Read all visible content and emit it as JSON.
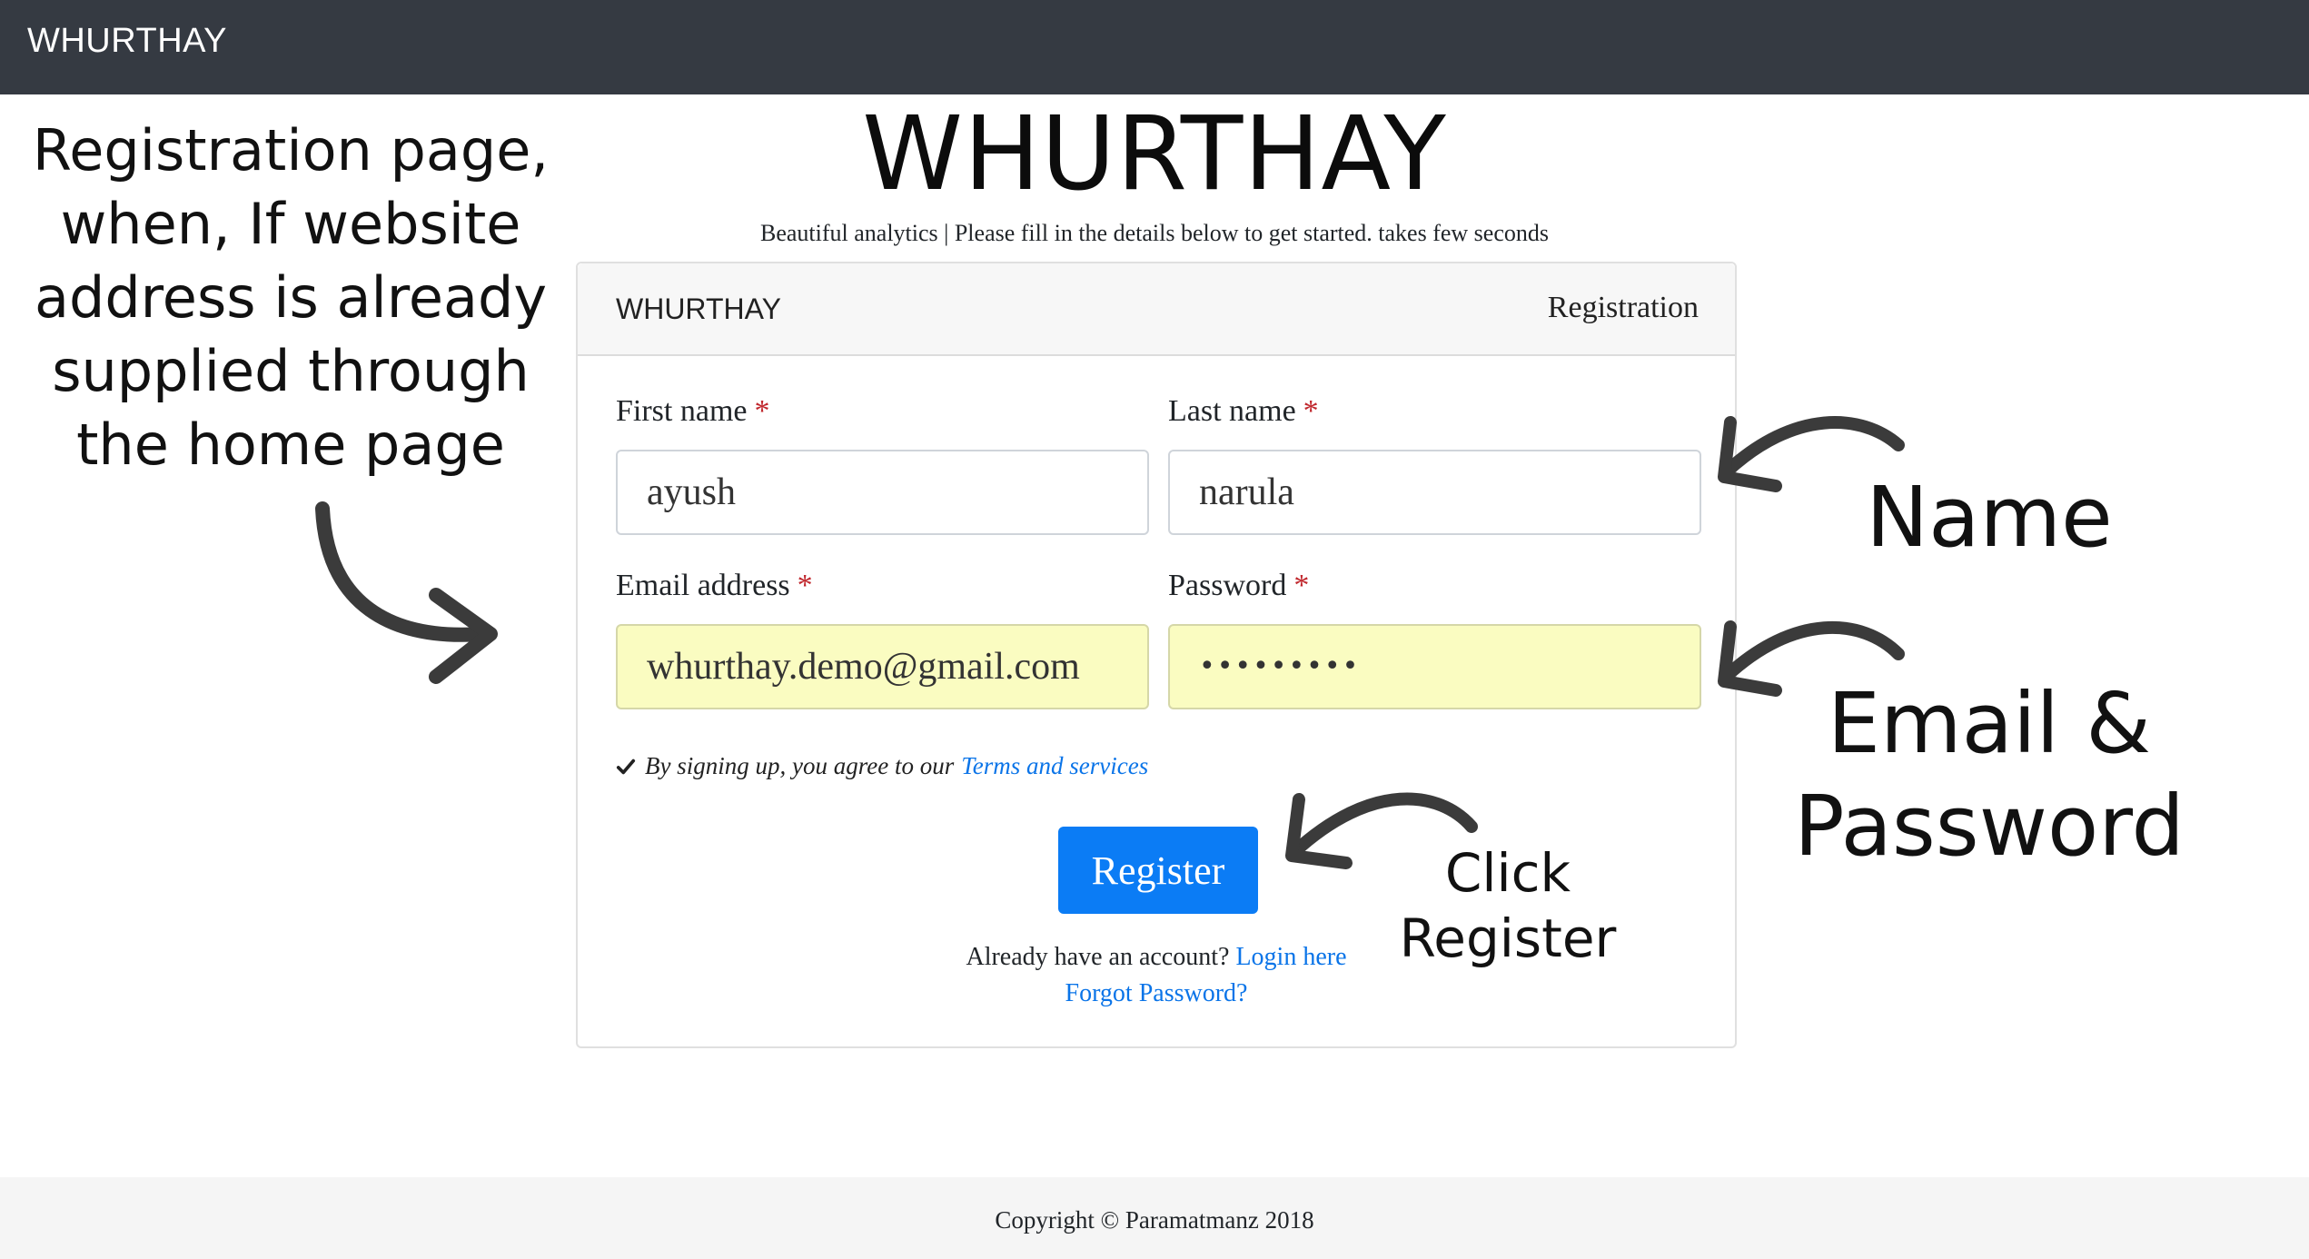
{
  "navbar": {
    "brand": "WHURTHAY"
  },
  "annotations": {
    "left": "Registration page, when, If website address is already supplied through the home page",
    "name": "Name",
    "email_password": "Email & Password",
    "click_register": "Click Register"
  },
  "header": {
    "title": "WHURTHAY",
    "tagline": "Beautiful analytics | Please fill in the details below to get started. takes few seconds"
  },
  "card": {
    "brand": "WHURTHAY",
    "title": "Registration"
  },
  "form": {
    "first_name": {
      "label": "First name",
      "required": "*",
      "value": "ayush"
    },
    "last_name": {
      "label": "Last name",
      "required": "*",
      "value": "narula"
    },
    "email": {
      "label": "Email address",
      "required": "*",
      "value": "whurthay.demo@gmail.com"
    },
    "password": {
      "label": "Password",
      "required": "*",
      "value": "•••••••••"
    },
    "terms_text": "By signing up, you agree to our",
    "terms_link": "Terms and services",
    "register_label": "Register",
    "already_text": "Already have an account?",
    "login_link": "Login here",
    "forgot_link": "Forgot Password?"
  },
  "footer": {
    "copyright": "Copyright © Paramatmanz 2018"
  },
  "colors": {
    "navbar_bg": "#353a42",
    "primary": "#0b7cf5",
    "link": "#0a74e8",
    "autofill": "#fafcc1",
    "required": "#c0272d"
  },
  "icons": [
    "check-icon",
    "curved-arrow-icon"
  ]
}
